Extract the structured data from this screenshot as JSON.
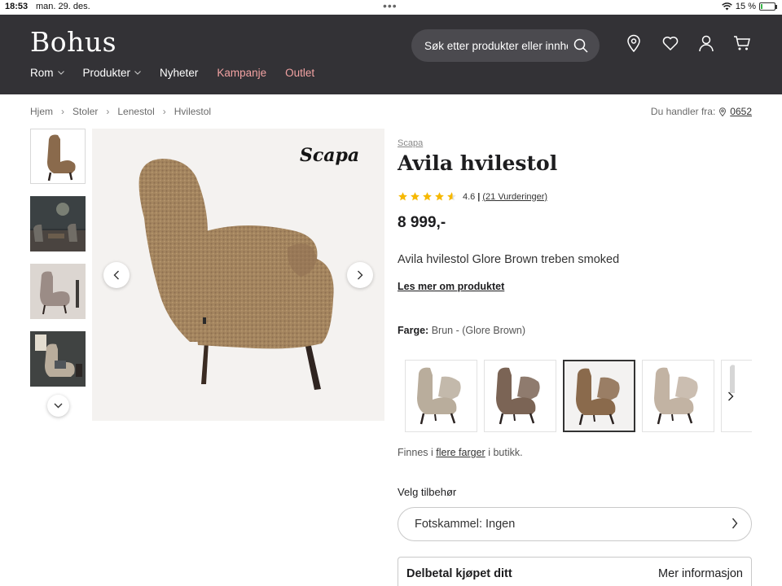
{
  "status_bar": {
    "time": "18:53",
    "date": "man. 29. des.",
    "battery": "15 %",
    "battery_level": 0.15
  },
  "header": {
    "logo": "Bohus",
    "search": {
      "placeholder": "Søk etter produkter eller innhold"
    },
    "icons": [
      "location-pin-icon",
      "heart-icon",
      "user-icon",
      "cart-icon"
    ],
    "nav": [
      {
        "label": "Rom",
        "dropdown": true
      },
      {
        "label": "Produkter",
        "dropdown": true
      },
      {
        "label": "Nyheter",
        "dropdown": false
      },
      {
        "label": "Kampanje",
        "dropdown": false,
        "color": "#f2a2a2"
      },
      {
        "label": "Outlet",
        "dropdown": false,
        "color": "#f2a2a2"
      }
    ]
  },
  "breadcrumb": [
    "Hjem",
    "Stoler",
    "Lenestol",
    "Hvilestol"
  ],
  "store": {
    "label": "Du handler fra:",
    "code": "0652"
  },
  "gallery": {
    "brand_watermark": "Scapa",
    "thumbnail_count": 4
  },
  "product": {
    "brand": "Scapa",
    "title": "Avila hvilestol",
    "rating": 4.6,
    "rating_text": "4.6",
    "reviews": "(21 Vurderinger)",
    "price": "8 999,-",
    "short_description": "Avila hvilestol Glore Brown treben smoked",
    "read_more": "Les mer om produktet",
    "color_label": "Farge:",
    "color_value": "Brun - (Glore Brown)",
    "swatch_colors": [
      "#b9ad9c",
      "#7b6455",
      "#8a6a4c",
      "#c2b3a3"
    ],
    "selected_swatch": 2,
    "availability_prefix": "Finnes i",
    "availability_link": "flere farger",
    "availability_suffix": "i butikk.",
    "accessory_label": "Velg tilbehør",
    "accessory_select": "Fotskammel: Ingen",
    "installment_label": "Delbetal kjøpet ditt",
    "installment_link": "Mer informasjon"
  },
  "colors": {
    "header_bg": "#333236",
    "accent_pink": "#f2a2a2",
    "star": "#f6b800"
  }
}
